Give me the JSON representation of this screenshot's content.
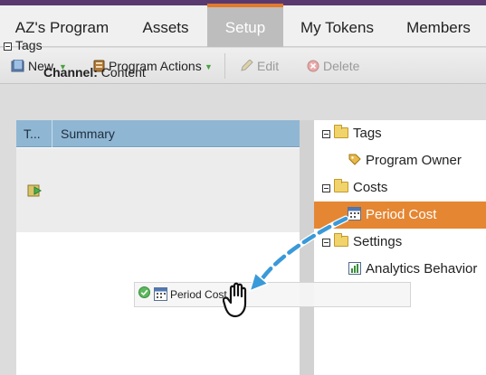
{
  "tabs": [
    {
      "label": "AZ's Program",
      "active": false
    },
    {
      "label": "Assets",
      "active": false
    },
    {
      "label": "Setup",
      "active": true
    },
    {
      "label": "My Tokens",
      "active": false
    },
    {
      "label": "Members",
      "active": false
    }
  ],
  "toolbar": {
    "new_label": "New",
    "program_actions_label": "Program Actions",
    "edit_label": "Edit",
    "delete_label": "Delete"
  },
  "summary_grid": {
    "col_type": "T...",
    "col_summary": "Summary",
    "group_label": "Tags",
    "row_key": "Channel:",
    "row_value": "Content"
  },
  "tree": {
    "tags_label": "Tags",
    "program_owner_label": "Program Owner",
    "costs_label": "Costs",
    "period_cost_label": "Period Cost",
    "settings_label": "Settings",
    "analytics_label": "Analytics Behavior"
  },
  "drag": {
    "ghost_label": "Period Cost"
  },
  "colors": {
    "active_tab_accent": "#e37a2c",
    "selected_item": "#e58633",
    "grid_header": "#8fb7d4",
    "drag_arrow": "#3a9ad9"
  }
}
